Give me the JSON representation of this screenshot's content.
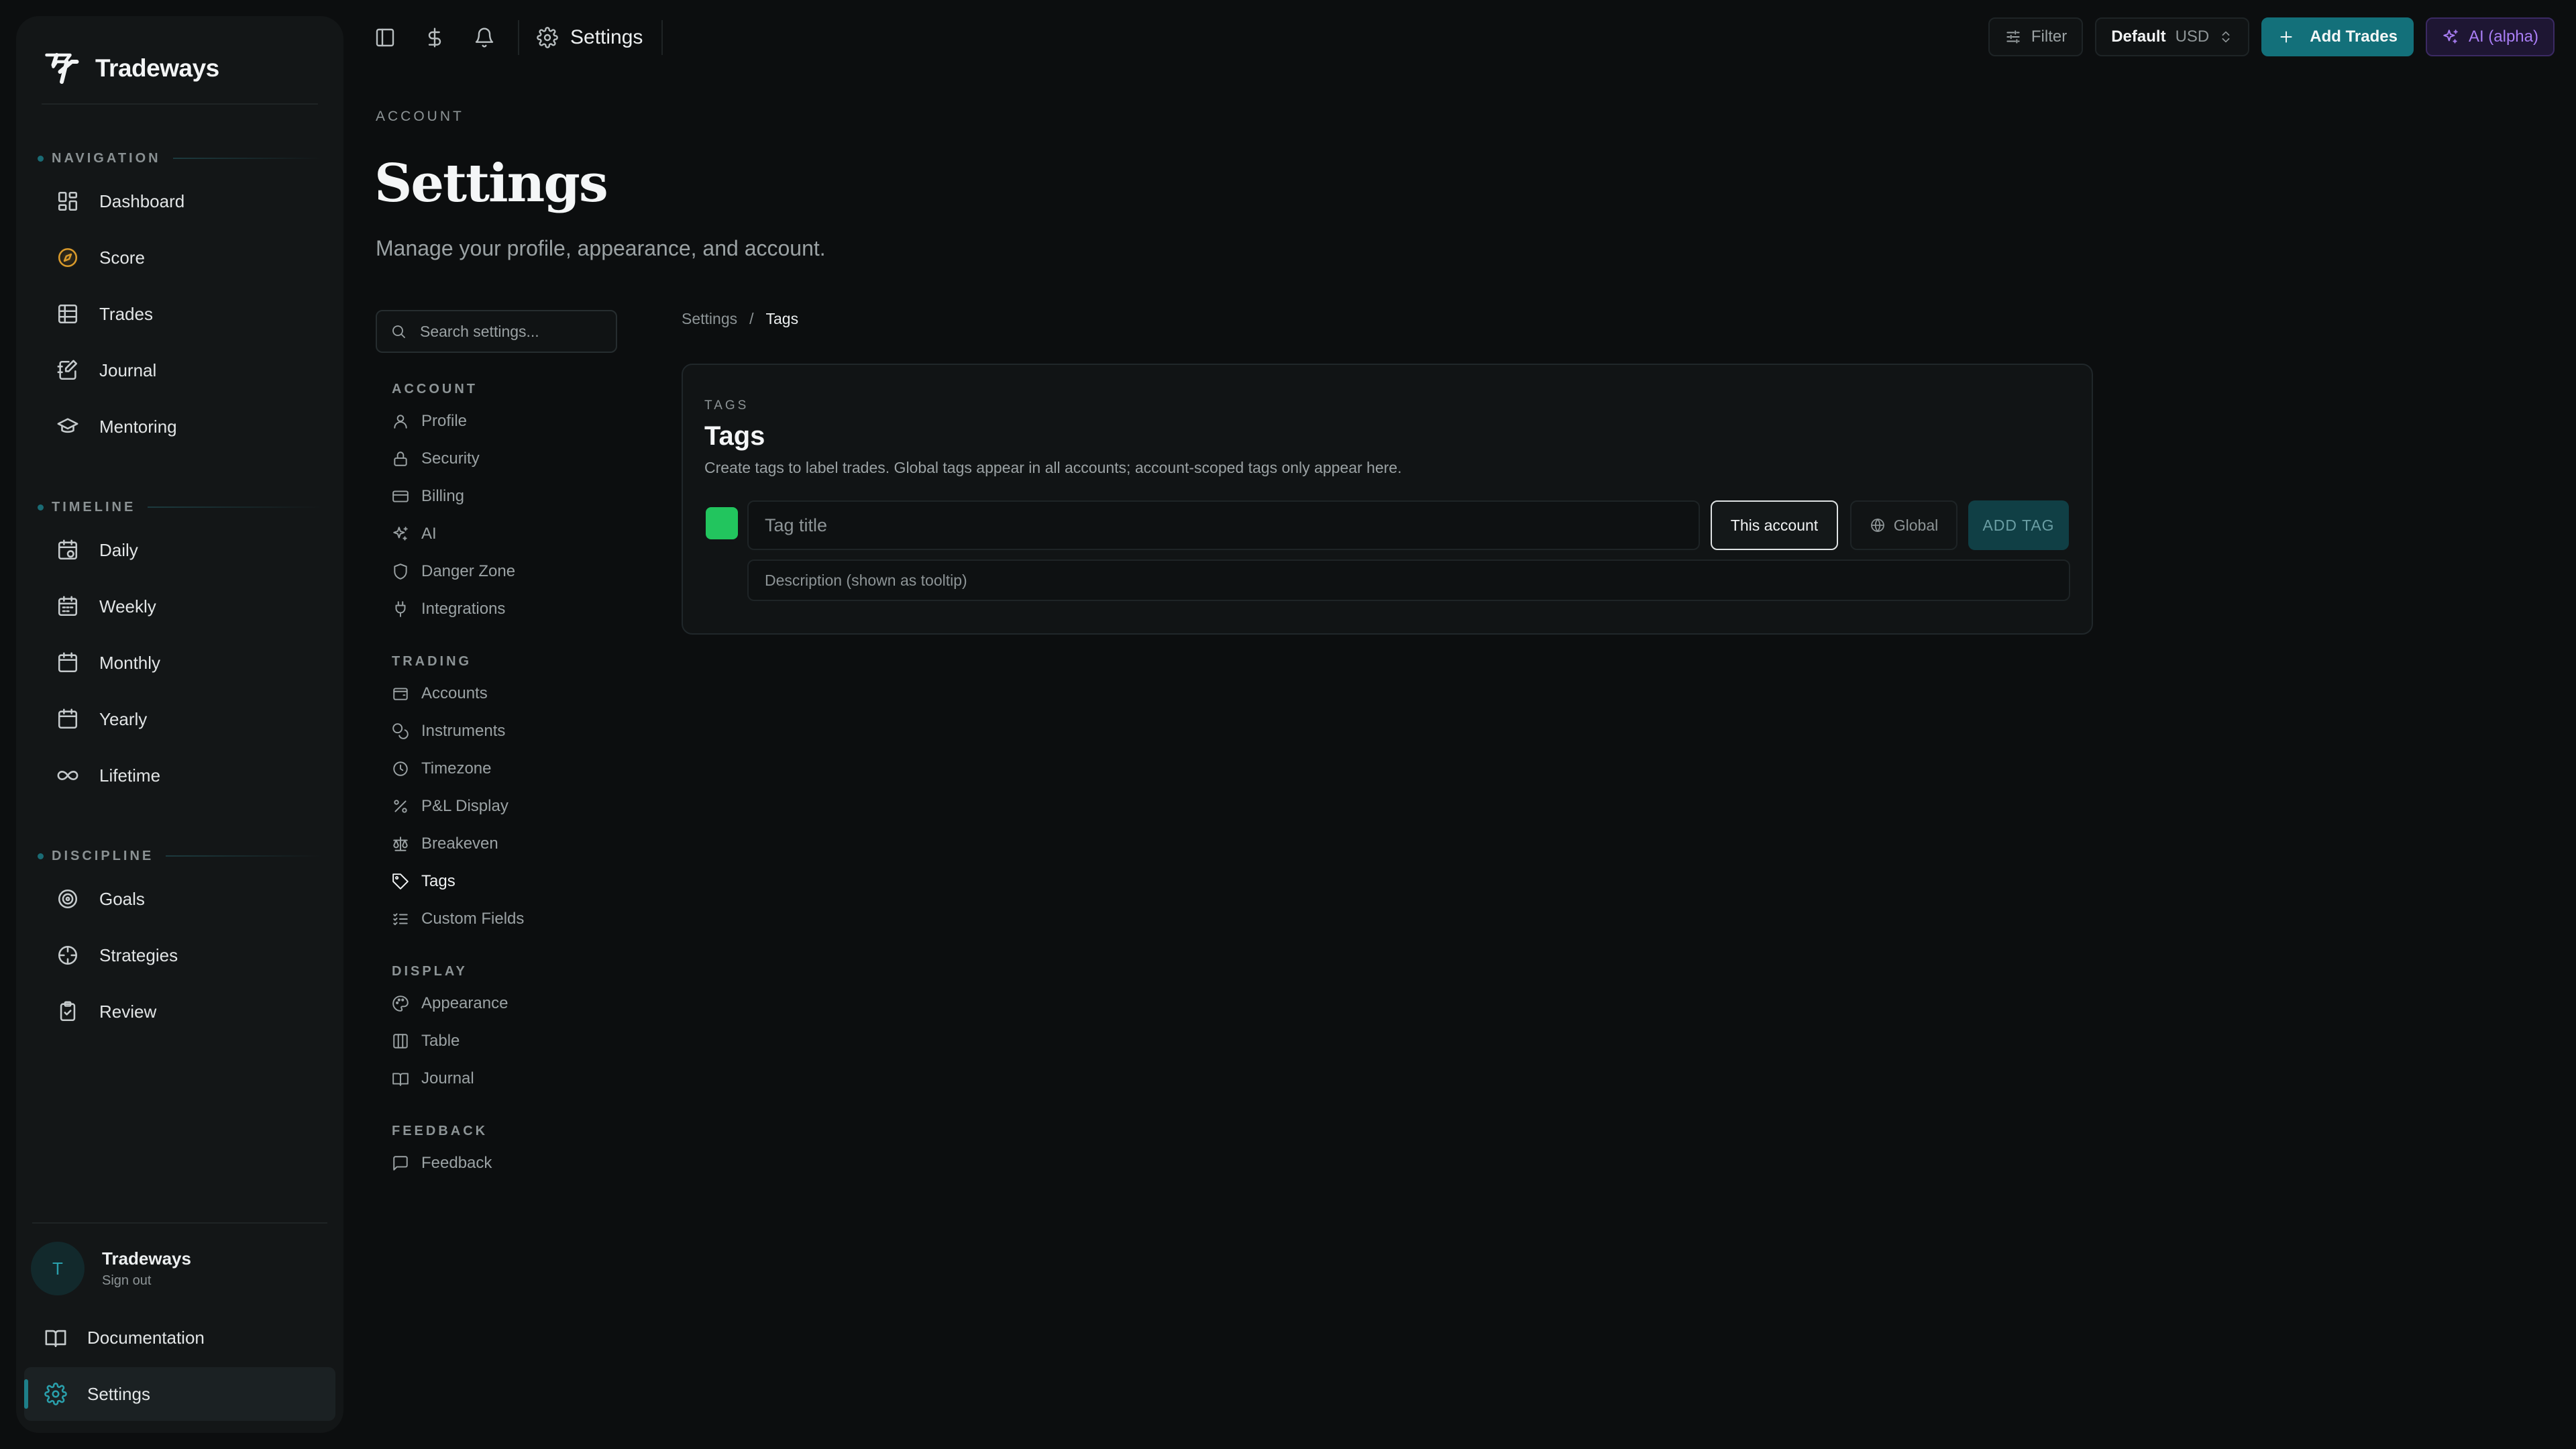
{
  "app": {
    "name": "Tradeways"
  },
  "sidebar": {
    "sections": [
      {
        "label": "NAVIGATION",
        "items": [
          {
            "label": "Dashboard",
            "icon": "dashboard-icon"
          },
          {
            "label": "Score",
            "icon": "compass-icon"
          },
          {
            "label": "Trades",
            "icon": "table-icon"
          },
          {
            "label": "Journal",
            "icon": "journal-icon"
          },
          {
            "label": "Mentoring",
            "icon": "graduation-cap-icon"
          }
        ]
      },
      {
        "label": "TIMELINE",
        "items": [
          {
            "label": "Daily",
            "icon": "calendar-clock-icon"
          },
          {
            "label": "Weekly",
            "icon": "calendar-icon"
          },
          {
            "label": "Monthly",
            "icon": "calendar-icon"
          },
          {
            "label": "Yearly",
            "icon": "calendar-icon"
          },
          {
            "label": "Lifetime",
            "icon": "infinity-icon"
          }
        ]
      },
      {
        "label": "DISCIPLINE",
        "items": [
          {
            "label": "Goals",
            "icon": "target-icon"
          },
          {
            "label": "Strategies",
            "icon": "crosshair-icon"
          },
          {
            "label": "Review",
            "icon": "clipboard-check-icon"
          }
        ]
      }
    ],
    "user": {
      "initial": "T",
      "name": "Tradeways",
      "sub": "Sign out"
    },
    "bottom": {
      "docs": "Documentation",
      "settings": "Settings"
    }
  },
  "topbar": {
    "title": "Settings",
    "filter": "Filter",
    "account_name": "Default",
    "currency": "USD",
    "add_trades": "Add Trades",
    "ai": "AI (alpha)"
  },
  "page": {
    "eyebrow": "ACCOUNT",
    "title": "Settings",
    "subtitle": "Manage your profile, appearance, and account."
  },
  "settings_nav": {
    "search_placeholder": "Search settings...",
    "groups": [
      {
        "label": "ACCOUNT",
        "items": [
          "Profile",
          "Security",
          "Billing",
          "AI",
          "Danger Zone",
          "Integrations"
        ]
      },
      {
        "label": "TRADING",
        "items": [
          "Accounts",
          "Instruments",
          "Timezone",
          "P&L Display",
          "Breakeven",
          "Tags",
          "Custom Fields"
        ]
      },
      {
        "label": "DISPLAY",
        "items": [
          "Appearance",
          "Table",
          "Journal"
        ]
      },
      {
        "label": "FEEDBACK",
        "items": [
          "Feedback"
        ]
      }
    ],
    "active": "Tags"
  },
  "breadcrumb": {
    "root": "Settings",
    "sep": "/",
    "current": "Tags"
  },
  "tags_card": {
    "eyebrow": "TAGS",
    "title": "Tags",
    "description": "Create tags to label trades. Global tags appear in all accounts; account-scoped tags only appear here.",
    "swatch_color": "#22c55e",
    "title_placeholder": "Tag title",
    "scope_account": "This account",
    "scope_global": "Global",
    "add_label": "ADD TAG",
    "desc_placeholder": "Description (shown as tooltip)"
  },
  "colors": {
    "accent": "#13707a",
    "ai_purple": "#a97ef5",
    "score_amber": "#d99a2b"
  }
}
